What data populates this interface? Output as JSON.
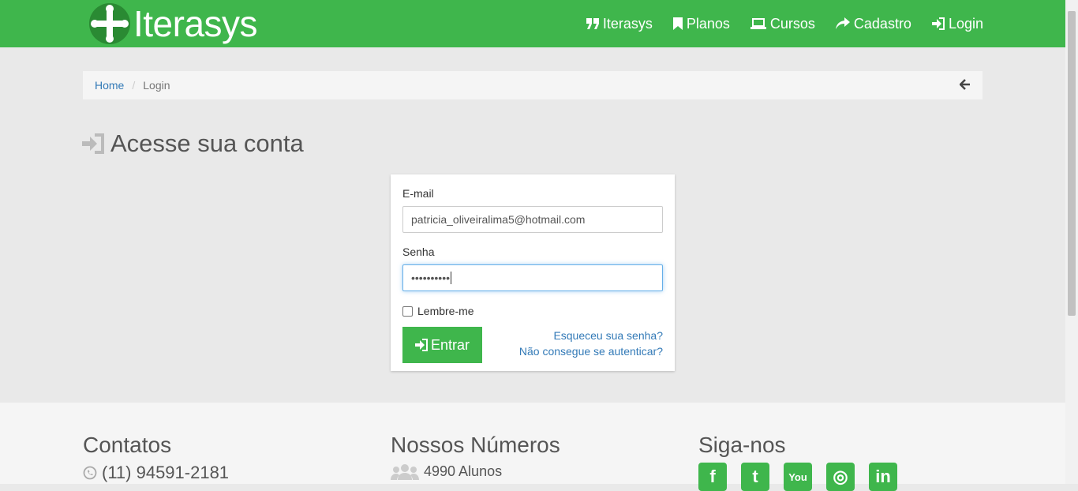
{
  "brand": {
    "name": "Iterasys",
    "accent": "#3fb64c"
  },
  "nav": [
    {
      "label": "Iterasys",
      "icon": "quote-icon"
    },
    {
      "label": "Planos",
      "icon": "bookmark-icon"
    },
    {
      "label": "Cursos",
      "icon": "laptop-icon"
    },
    {
      "label": "Cadastro",
      "icon": "share-icon"
    },
    {
      "label": "Login",
      "icon": "sign-in-icon"
    }
  ],
  "breadcrumb": {
    "home": "Home",
    "separator": "/",
    "current": "Login",
    "back_icon": "arrow-left-icon"
  },
  "page": {
    "title": "Acesse sua conta",
    "title_icon": "sign-in-icon"
  },
  "form": {
    "email_label": "E-mail",
    "email_value": "patricia_oliveiralima5@hotmail.com",
    "password_label": "Senha",
    "password_value": "••••••••••",
    "remember_label": "Lembre-me",
    "remember_checked": false,
    "submit_label": "Entrar",
    "forgot_link": "Esqueceu sua senha?",
    "cant_auth_link": "Não consegue se autenticar?"
  },
  "footer": {
    "contacts": {
      "title": "Contatos",
      "phone": "(11) 94591-2181",
      "phone_icon": "whatsapp-icon"
    },
    "numbers": {
      "title": "Nossos Números",
      "students": "4990 Alunos",
      "students_icon": "users-icon"
    },
    "social": {
      "title": "Siga-nos",
      "networks": [
        {
          "glyph": "f",
          "icon": "facebook-icon"
        },
        {
          "glyph": "t",
          "icon": "twitter-icon"
        },
        {
          "glyph": "You",
          "icon": "youtube-icon"
        },
        {
          "glyph": "◎",
          "icon": "instagram-icon"
        },
        {
          "glyph": "in",
          "icon": "linkedin-icon"
        }
      ]
    }
  }
}
